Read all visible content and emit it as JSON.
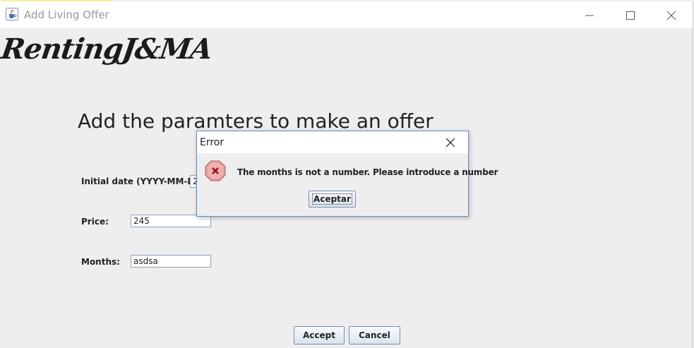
{
  "window": {
    "title": "Add Living Offer",
    "icon": "java-cup-icon"
  },
  "logo": "RentingJ&MA",
  "heading": "Add the paramters to make an offer",
  "form": {
    "initial_date": {
      "label": "Initial date (YYYY-MM-DD):",
      "value": "2"
    },
    "price": {
      "label": "Price:",
      "value": "245"
    },
    "months": {
      "label": "Months:",
      "value": "asdsa"
    }
  },
  "buttons": {
    "accept": "Accept",
    "cancel": "Cancel"
  },
  "dialog": {
    "title": "Error",
    "message": "The months is not a number. Please introduce a number",
    "button": "Aceptar",
    "icon": "error-x-icon"
  },
  "colors": {
    "dialog_border": "#5b8fc9",
    "error_icon_fill": "#e8a0a0",
    "error_icon_x": "#9c1010"
  }
}
